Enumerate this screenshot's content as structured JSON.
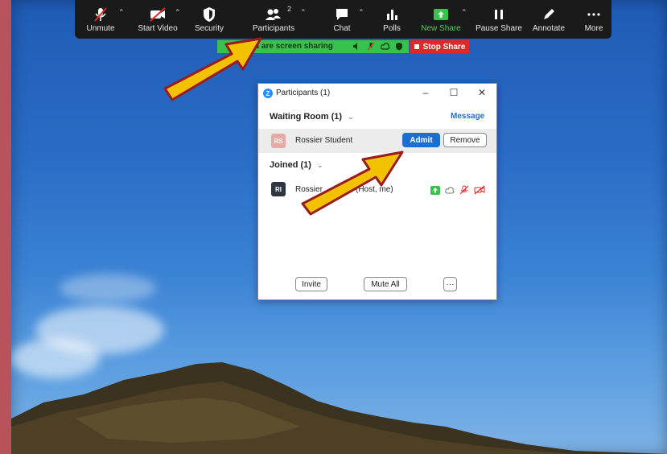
{
  "toolbar": {
    "buttons": [
      {
        "label": "Unmute",
        "icon": "mic-muted-icon"
      },
      {
        "label": "Start Video",
        "icon": "video-off-icon"
      },
      {
        "label": "Security",
        "icon": "shield-icon"
      },
      {
        "label": "Participants",
        "icon": "participants-icon",
        "count": "2"
      },
      {
        "label": "Chat",
        "icon": "chat-icon"
      },
      {
        "label": "Polls",
        "icon": "polls-icon"
      },
      {
        "label": "New Share",
        "icon": "share-up-icon"
      },
      {
        "label": "Pause Share",
        "icon": "pause-icon"
      },
      {
        "label": "Annotate",
        "icon": "pen-icon"
      },
      {
        "label": "More",
        "icon": "more-icon"
      }
    ]
  },
  "share_bar": {
    "text": "You are screen sharing",
    "stop_label": "Stop Share"
  },
  "participants_window": {
    "title": "Participants (1)",
    "waiting_room_label": "Waiting Room (1)",
    "message_label": "Message",
    "waiting": {
      "initials": "RS",
      "name": "Rossier Student",
      "admit_label": "Admit",
      "remove_label": "Remove"
    },
    "joined_label": "Joined (1)",
    "joined": {
      "initials": "RI",
      "name": "Rossier",
      "name_suffix": "(Host, me)"
    },
    "invite_label": "Invite",
    "mute_all_label": "Mute All",
    "more_label": "···"
  },
  "colors": {
    "accent_blue": "#1a6fd1",
    "share_green": "#36c24b",
    "stop_red": "#e02828",
    "arrow_fill": "#f2c200",
    "arrow_stroke": "#9a1b1b"
  }
}
